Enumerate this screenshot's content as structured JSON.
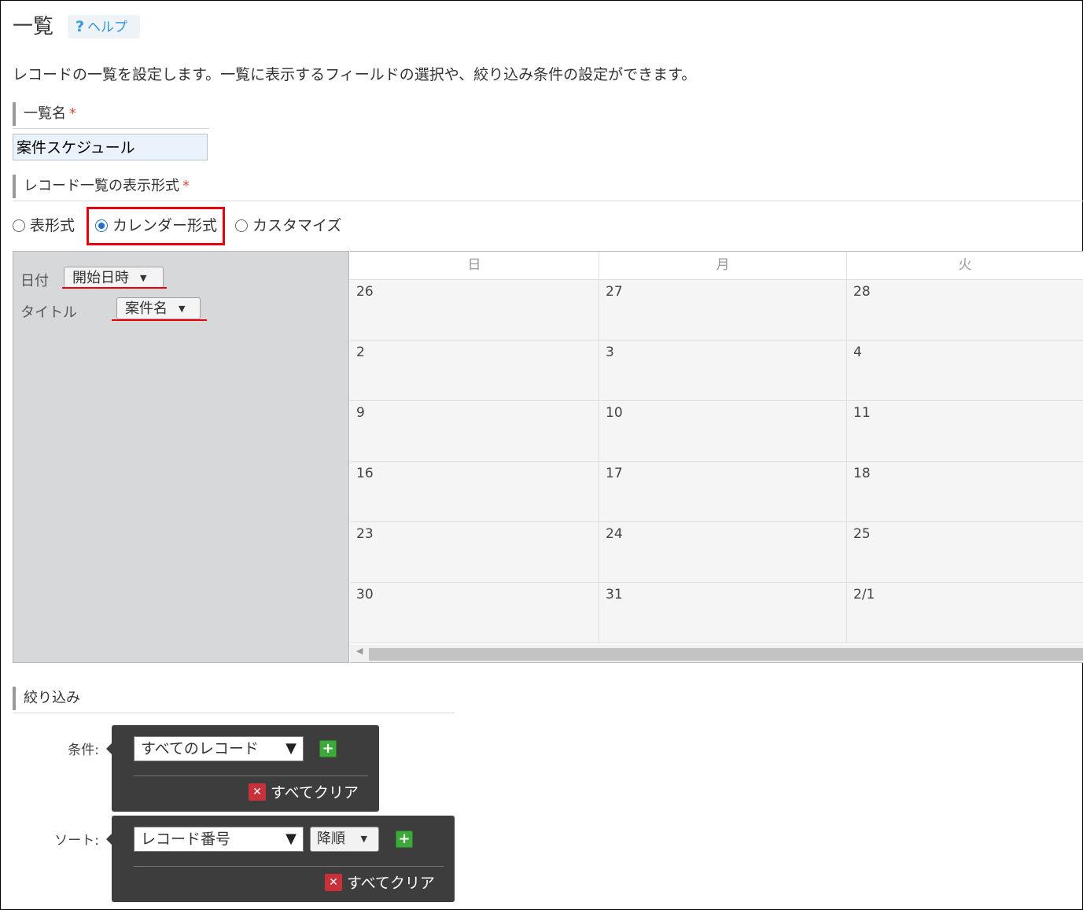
{
  "page": {
    "title": "一覧",
    "help_label": "ヘルプ",
    "help_icon": "question-icon",
    "description": "レコードの一覧を設定します。一覧に表示するフィールドの選択や、絞り込み条件の設定ができます。"
  },
  "list_name": {
    "label": "一覧名",
    "required_mark": "*",
    "value": "案件スケジュール"
  },
  "display_format": {
    "label": "レコード一覧の表示形式",
    "required_mark": "*",
    "options": [
      {
        "label": "表形式",
        "selected": false
      },
      {
        "label": "カレンダー形式",
        "selected": true
      },
      {
        "label": "カスタマイズ",
        "selected": false
      }
    ]
  },
  "calendar_settings": {
    "date_label": "日付",
    "date_value": "開始日時",
    "title_label": "タイトル",
    "title_value": "案件名"
  },
  "calendar": {
    "weekdays": [
      "日",
      "月",
      "火"
    ],
    "rows": [
      [
        "26",
        "27",
        "28"
      ],
      [
        "2",
        "3",
        "4"
      ],
      [
        "9",
        "10",
        "11"
      ],
      [
        "16",
        "17",
        "18"
      ],
      [
        "23",
        "24",
        "25"
      ],
      [
        "30",
        "31",
        "2/1"
      ]
    ]
  },
  "filter": {
    "label": "絞り込み",
    "condition_label": "条件:",
    "condition_value": "すべてのレコード",
    "sort_label": "ソート:",
    "sort_field": "レコード番号",
    "sort_order": "降順",
    "clear_all_label": "すべてクリア",
    "add_icon": "plus-icon",
    "clear_icon": "close-icon"
  },
  "colors": {
    "accent_blue": "#1e6fd9",
    "highlight_red": "#e8000b",
    "add_green": "#3ea83b",
    "clear_red": "#c8303a"
  }
}
